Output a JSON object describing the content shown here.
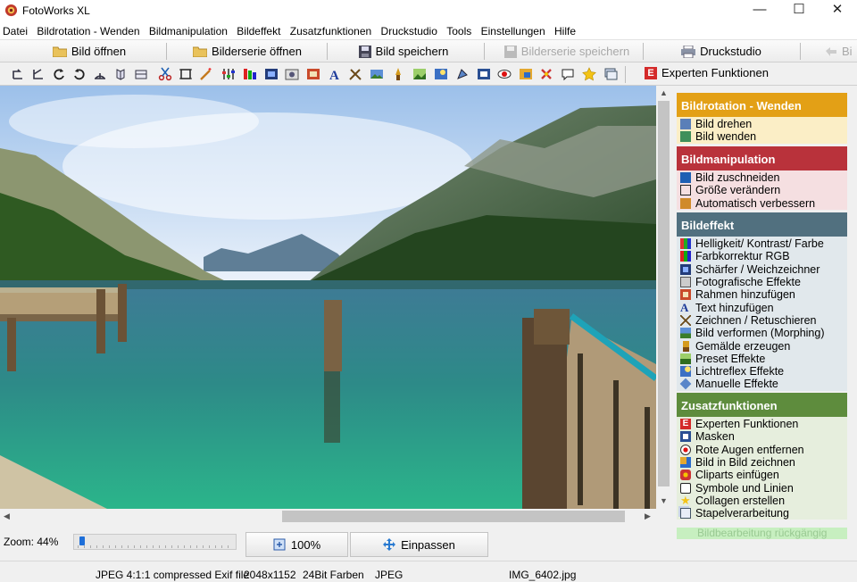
{
  "window": {
    "title": "FotoWorks XL",
    "minimize_glyph": "—",
    "maximize_glyph": "☐",
    "close_glyph": "✕"
  },
  "menu": [
    "Datei",
    "Bildrotation - Wenden",
    "Bildmanipulation",
    "Bildeffekt",
    "Zusatzfunktionen",
    "Druckstudio",
    "Tools",
    "Einstellungen",
    "Hilfe"
  ],
  "toolbar": {
    "open_image": "Bild öffnen",
    "open_series": "Bilderserie öffnen",
    "save_image": "Bild speichern",
    "save_series": "Bilderserie speichern",
    "print_studio": "Druckstudio",
    "cut_off": "Bi",
    "expert_badge": "E",
    "expert_functions": "Experten Funktionen"
  },
  "sidebar": {
    "sections": [
      {
        "title": "Bildrotation - Wenden",
        "color": "#e3a016",
        "item_bg": "#fbeec6",
        "items": [
          "Bild drehen",
          "Bild wenden"
        ]
      },
      {
        "title": "Bildmanipulation",
        "color": "#b9323b",
        "item_bg": "#f5dfe1",
        "items": [
          "Bild zuschneiden",
          "Größe verändern",
          "Automatisch verbessern"
        ]
      },
      {
        "title": "Bildeffekt",
        "color": "#51707f",
        "item_bg": "#e1e8ec",
        "items": [
          "Helligkeit/ Kontrast/ Farbe",
          "Farbkorrektur RGB",
          "Schärfer / Weichzeichner",
          "Fotografische Effekte",
          "Rahmen hinzufügen",
          "Text hinzufügen",
          "Zeichnen / Retuschieren",
          "Bild verformen (Morphing)",
          "Gemälde erzeugen",
          "Preset Effekte",
          "Lichtreflex Effekte",
          "Manuelle Effekte"
        ]
      },
      {
        "title": "Zusatzfunktionen",
        "color": "#5e8c3d",
        "item_bg": "#e6eedd",
        "items": [
          "Experten Funktionen",
          "Masken",
          "Rote Augen entfernen",
          "Bild in Bild zeichnen",
          "Cliparts einfügen",
          "Symbole und Linien",
          "Collagen erstellen",
          "Stapelverarbeitung"
        ]
      }
    ],
    "undo": "Bildbearbeitung rückgängig"
  },
  "zoom": {
    "label": "Zoom: 44%",
    "percent": 44,
    "btn_100": "100%",
    "btn_fit": "Einpassen"
  },
  "status": {
    "format": "JPEG 4:1:1 compressed Exif file",
    "resolution": "2048x1152",
    "colors": "24Bit Farben",
    "type": "JPEG",
    "filename": "IMG_6402.jpg"
  }
}
